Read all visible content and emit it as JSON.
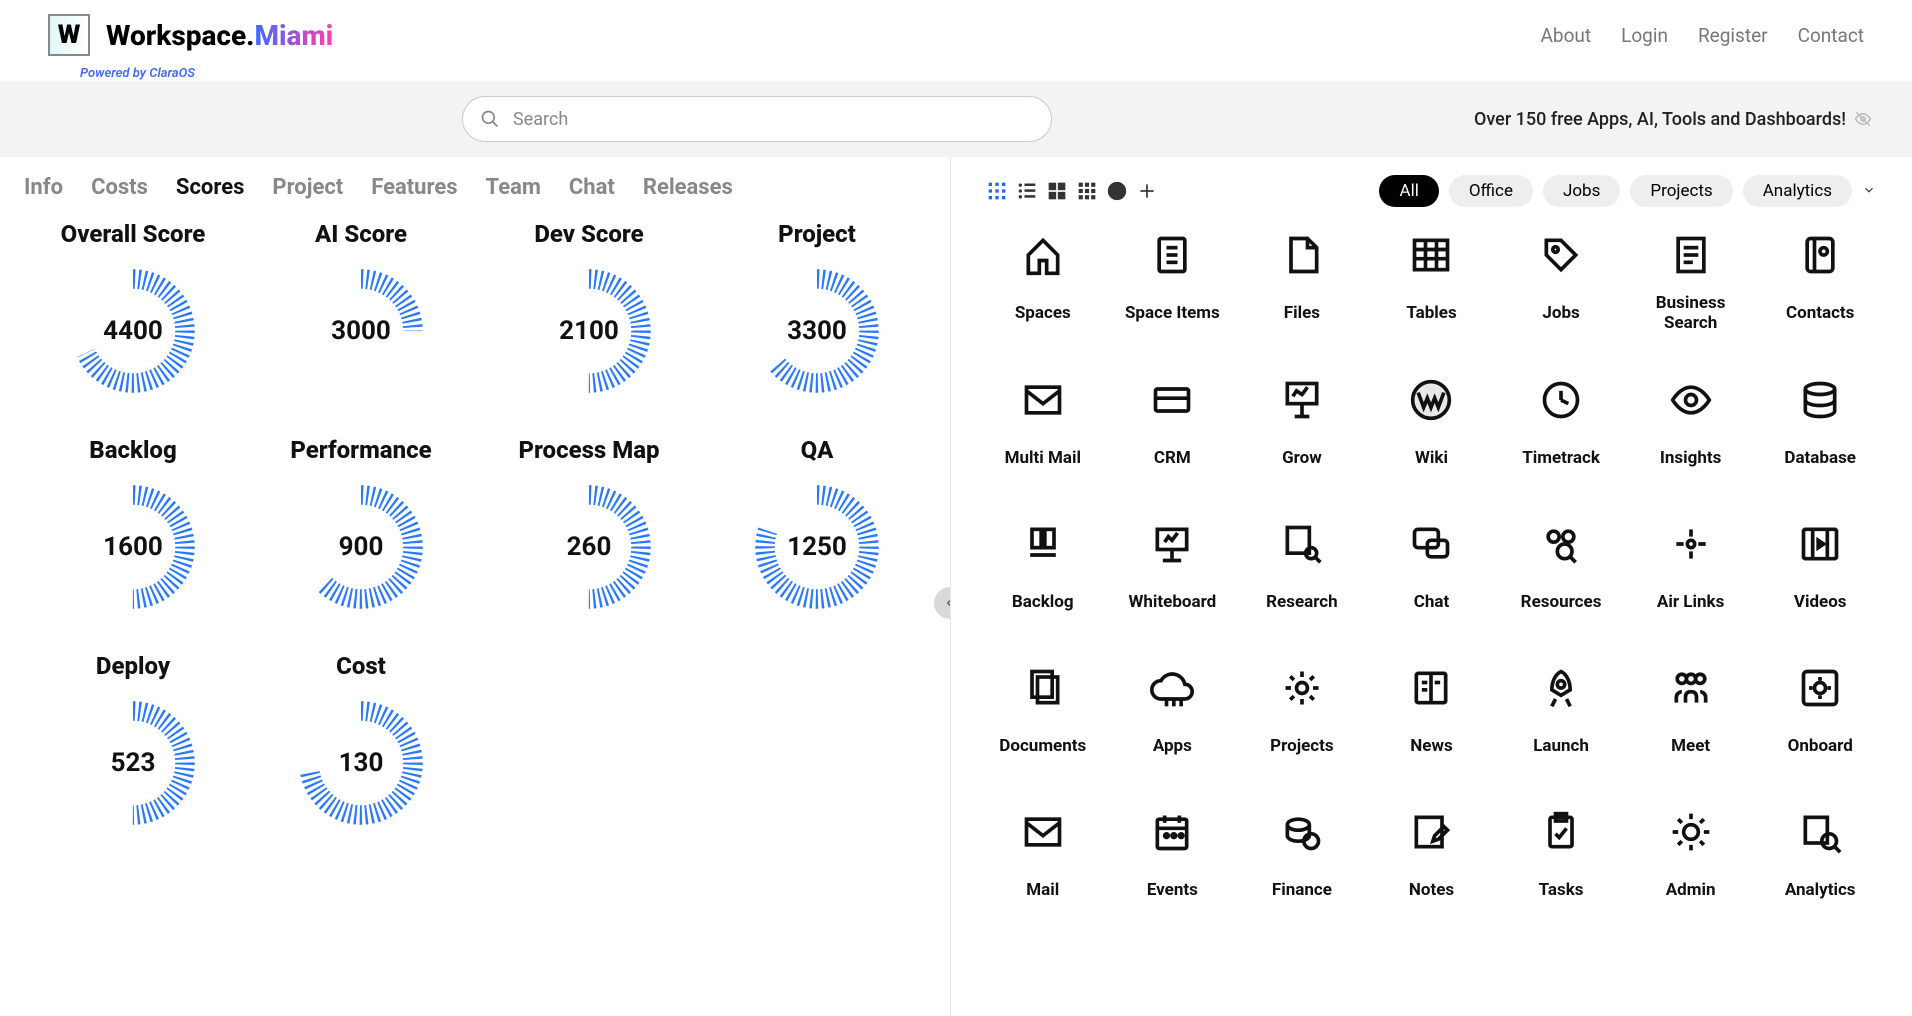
{
  "brand": {
    "name": "Workspace.",
    "accent": "Miami",
    "powered": "Powered by ClaraOS",
    "logo": "W"
  },
  "nav": [
    "About",
    "Login",
    "Register",
    "Contact"
  ],
  "search": {
    "placeholder": "Search"
  },
  "tagline": "Over 150 free Apps, AI, Tools and Dashboards!",
  "tabs": [
    "Info",
    "Costs",
    "Scores",
    "Project",
    "Features",
    "Team",
    "Chat",
    "Releases"
  ],
  "active_tab": "Scores",
  "scores": [
    {
      "title": "Overall Score",
      "value": 4400,
      "pct": 68
    },
    {
      "title": "AI Score",
      "value": 3000,
      "pct": 25
    },
    {
      "title": "Dev Score",
      "value": 2100,
      "pct": 50
    },
    {
      "title": "Project",
      "value": 3300,
      "pct": 64
    },
    {
      "title": "Backlog",
      "value": 1600,
      "pct": 50
    },
    {
      "title": "Performance",
      "value": 900,
      "pct": 62
    },
    {
      "title": "Process Map",
      "value": 260,
      "pct": 50
    },
    {
      "title": "QA",
      "value": 1250,
      "pct": 80
    },
    {
      "title": "Deploy",
      "value": 523,
      "pct": 50
    },
    {
      "title": "Cost",
      "value": 130,
      "pct": 72
    }
  ],
  "filters": [
    "All",
    "Office",
    "Jobs",
    "Projects",
    "Analytics"
  ],
  "active_filter": "All",
  "apps": [
    {
      "label": "Spaces",
      "icon": "home"
    },
    {
      "label": "Space Items",
      "icon": "doc"
    },
    {
      "label": "Files",
      "icon": "page"
    },
    {
      "label": "Tables",
      "icon": "table"
    },
    {
      "label": "Jobs",
      "icon": "tag"
    },
    {
      "label": "Business Search",
      "icon": "listsearch"
    },
    {
      "label": "Contacts",
      "icon": "book"
    },
    {
      "label": "Multi Mail",
      "icon": "mail"
    },
    {
      "label": "CRM",
      "icon": "card"
    },
    {
      "label": "Grow",
      "icon": "board"
    },
    {
      "label": "Wiki",
      "icon": "wiki"
    },
    {
      "label": "Timetrack",
      "icon": "clock"
    },
    {
      "label": "Insights",
      "icon": "eye"
    },
    {
      "label": "Database",
      "icon": "db"
    },
    {
      "label": "Backlog",
      "icon": "stack"
    },
    {
      "label": "Whiteboard",
      "icon": "easel"
    },
    {
      "label": "Research",
      "icon": "research"
    },
    {
      "label": "Chat",
      "icon": "chat"
    },
    {
      "label": "Resources",
      "icon": "people"
    },
    {
      "label": "Air Links",
      "icon": "link"
    },
    {
      "label": "Videos",
      "icon": "video"
    },
    {
      "label": "Documents",
      "icon": "docs"
    },
    {
      "label": "Apps",
      "icon": "cloud"
    },
    {
      "label": "Projects",
      "icon": "gear"
    },
    {
      "label": "News",
      "icon": "news"
    },
    {
      "label": "Launch",
      "icon": "rocket"
    },
    {
      "label": "Meet",
      "icon": "meet"
    },
    {
      "label": "Onboard",
      "icon": "target"
    },
    {
      "label": "Mail",
      "icon": "mail"
    },
    {
      "label": "Events",
      "icon": "calendar"
    },
    {
      "label": "Finance",
      "icon": "coins"
    },
    {
      "label": "Notes",
      "icon": "pencil"
    },
    {
      "label": "Tasks",
      "icon": "check"
    },
    {
      "label": "Admin",
      "icon": "cog"
    },
    {
      "label": "Analytics",
      "icon": "analytics"
    }
  ],
  "chart_data": {
    "type": "bar",
    "title": "Scores",
    "categories": [
      "Overall Score",
      "AI Score",
      "Dev Score",
      "Project",
      "Backlog",
      "Performance",
      "Process Map",
      "QA",
      "Deploy",
      "Cost"
    ],
    "values": [
      4400,
      3000,
      2100,
      3300,
      1600,
      900,
      260,
      1250,
      523,
      130
    ],
    "percent": [
      68,
      25,
      50,
      64,
      50,
      62,
      50,
      80,
      50,
      72
    ],
    "xlabel": "",
    "ylabel": "",
    "ylim": [
      0,
      5000
    ]
  }
}
